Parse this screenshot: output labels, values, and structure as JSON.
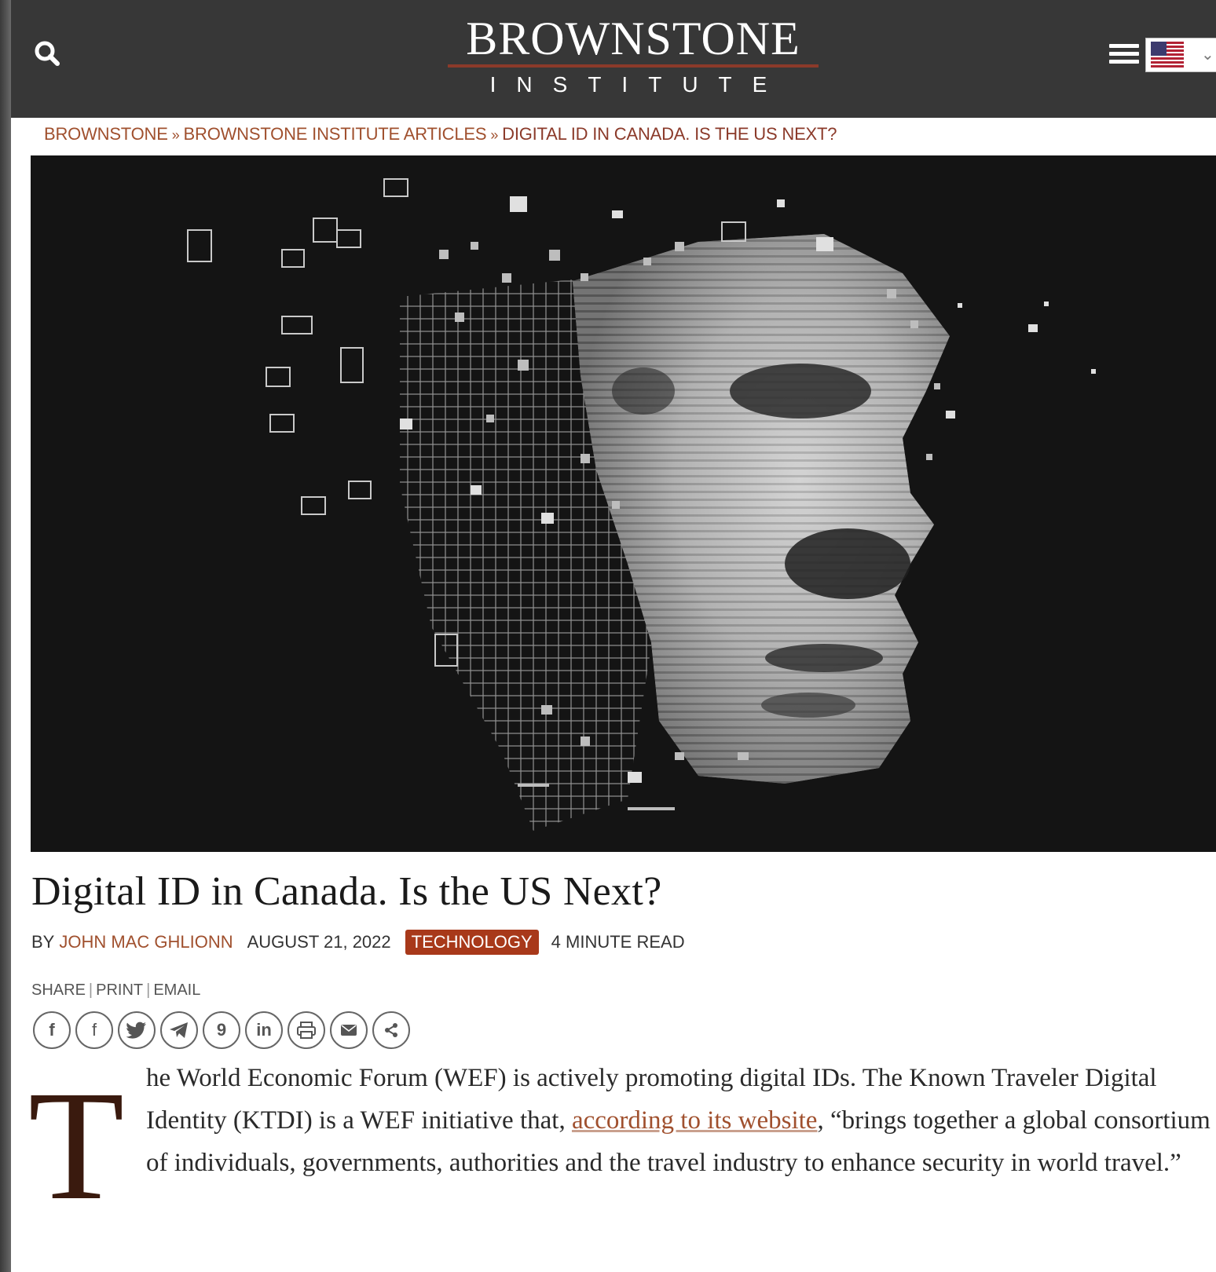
{
  "header": {
    "logo_title": "BROWNSTONE",
    "logo_subtitle": "INSTITUTE",
    "search_icon": "search-icon",
    "menu_icon": "hamburger-menu-icon",
    "language_flag": "us-flag-icon"
  },
  "breadcrumb": {
    "items": [
      "BROWNSTONE",
      "BROWNSTONE INSTITUTE ARTICLES"
    ],
    "separator": "»",
    "current": "DIGITAL ID IN CANADA. IS THE US NEXT?"
  },
  "hero": {
    "description_icon": "pixelated-face-image"
  },
  "article": {
    "title": "Digital ID in Canada. Is the US Next?",
    "by_label": "BY",
    "author": "JOHN MAC GHLIONN",
    "date": "AUGUST 21, 2022",
    "category": "TECHNOLOGY",
    "read_time": "4 MINUTE READ",
    "share_label": "SHARE",
    "print_label": "PRINT",
    "email_label": "EMAIL",
    "share_icons": [
      "facebook-icon",
      "facebook-like-icon",
      "twitter-icon",
      "telegram-icon",
      "gettr-icon",
      "linkedin-icon",
      "print-icon",
      "email-icon",
      "share-icon"
    ],
    "dropcap": "T",
    "body_before_link": "he World Economic Forum (WEF) is actively promoting digital IDs. The Known Traveler Digital Identity (KTDI) is a WEF initiative that, ",
    "body_link": "according to its website",
    "body_after_link": ", “brings together a global consortium of individuals, governments, authorities and the travel industry to enhance security in world travel.”"
  },
  "colors": {
    "header_bg": "#373737",
    "accent": "#a0502e",
    "tag_bg": "#a8391a",
    "logo_rule": "#8b3a2a"
  }
}
